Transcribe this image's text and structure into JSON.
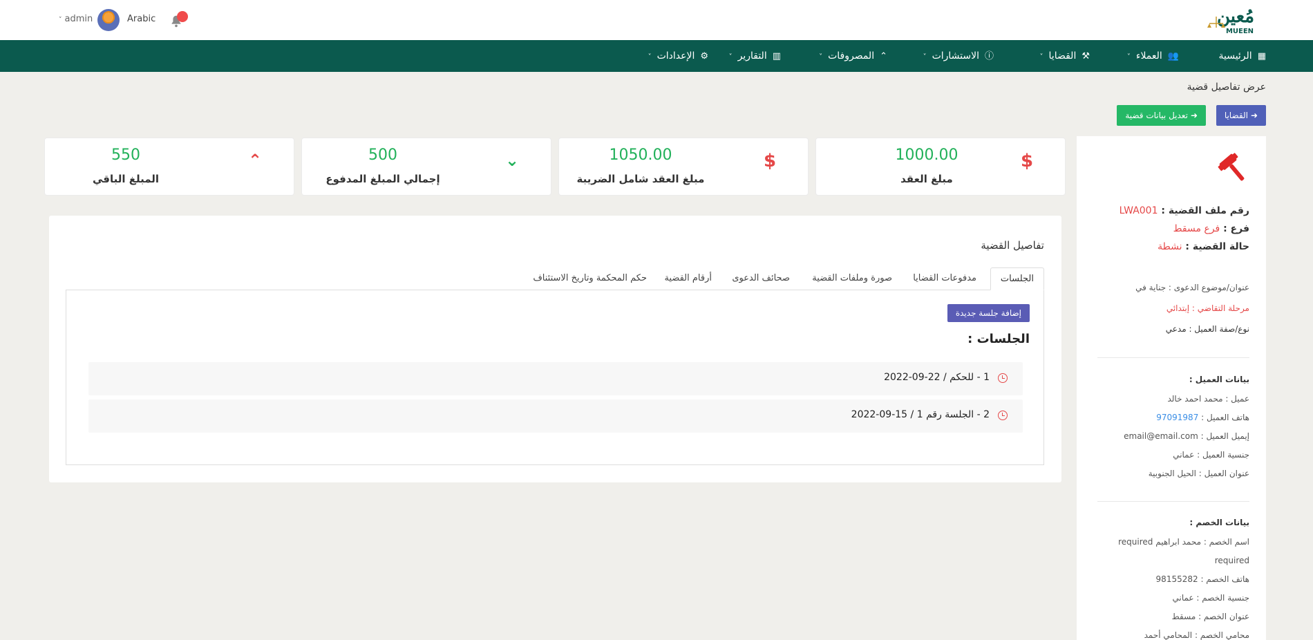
{
  "header": {
    "logo_text": "مُعين",
    "logo_subtitle": "MUEEN",
    "language": "Arabic",
    "user_name": "admin"
  },
  "nav": {
    "items": [
      {
        "label": "الرئيسية",
        "icon": "dashboard-icon",
        "dropdown": false
      },
      {
        "label": "العملاء",
        "icon": "users-icon",
        "dropdown": true
      },
      {
        "label": "القضايا",
        "icon": "gavel-icon",
        "dropdown": true
      },
      {
        "label": "الاستشارات",
        "icon": "info-icon",
        "dropdown": true
      },
      {
        "label": "المصروفات",
        "icon": "chevrons-up-icon",
        "dropdown": true
      },
      {
        "label": "التقارير",
        "icon": "bar-chart-icon",
        "dropdown": true
      },
      {
        "label": "الإعدادات",
        "icon": "gear-icon",
        "dropdown": true
      }
    ]
  },
  "page": {
    "title": "عرض تفاصيل قضية",
    "cases_button": "القضايا",
    "edit_button": "تعديل بيانات قضية"
  },
  "stats": [
    {
      "value": "1000.00",
      "label": "مبلغ العقد",
      "icon": "dollar-icon",
      "color": "#e54848"
    },
    {
      "value": "1050.00",
      "label": "مبلغ العقد شامل الضريبة",
      "icon": "dollar-icon",
      "color": "#e54848"
    },
    {
      "value": "500",
      "label": "إجمالي المبلغ المدفوع",
      "icon": "chevrons-down-icon",
      "color": "#22b15a"
    },
    {
      "value": "550",
      "label": "المبلغ الباقي",
      "icon": "chevrons-up-icon",
      "color": "#e54848"
    }
  ],
  "sidebar": {
    "case_file_label": "رقم ملف القضية :",
    "case_file_value": "LWA001",
    "branch_label": "فرع :",
    "branch_value": "فرع مسقط",
    "status_label": "حالة القضية :",
    "status_value": "نشطة",
    "subject": "عنوان/موضوع الدعوى : جناية في",
    "stage": "مرحلة التقاضي : إبتدائي",
    "client_type": "نوع/صفة العميل : مدعي",
    "client_header": "بيانات العميل :",
    "client_name": "عميل : محمد احمد خالد",
    "client_phone_label": "هاتف العميل :",
    "client_phone": "97091987",
    "client_email": "إيميل العميل : email@email.com",
    "client_nationality": "جنسية العميل : عماني",
    "client_address": "عنوان العميل : الحيل الجنوبية",
    "opponent_header": "بيانات الخصم :",
    "opponent_name": "اسم الخصم : محمد ابراهيم required",
    "opponent_name_cont": "required",
    "opponent_phone": "هاتف الخصم : 98155282",
    "opponent_nationality": "جنسية الخصم : عماني",
    "opponent_address": "عنوان الخصم : مسقط",
    "opponent_lawyer": "محامي الخصم : المحامي أحمد"
  },
  "details": {
    "title": "تفاصيل القضية",
    "tabs": [
      "الجلسات",
      "مدفوعات القضايا",
      "صورة وملفات القضية",
      "صحائف الدعوى",
      "أرقام القضية",
      "حكم المحكمة وتاريخ الاستئناف"
    ],
    "add_session_button": "إضافة جلسة جديدة",
    "sessions_title": "الجلسات :",
    "sessions": [
      "1 - للحكم / 22-09-2022",
      "2 - الجلسة رقم 1 / 15-09-2022"
    ]
  }
}
